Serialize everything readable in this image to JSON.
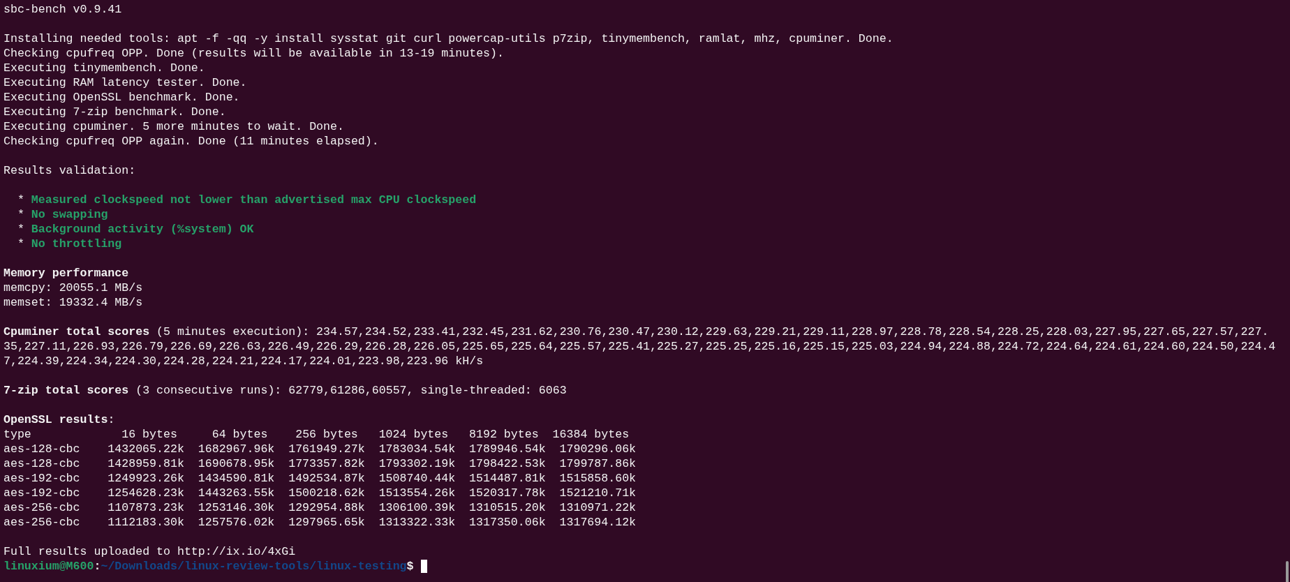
{
  "terminal": {
    "lines": [
      {
        "kind": "text",
        "text": "sbc-bench v0.9.41"
      },
      {
        "kind": "blank"
      },
      {
        "kind": "text",
        "text": "Installing needed tools: apt -f -qq -y install sysstat git curl powercap-utils p7zip, tinymembench, ramlat, mhz, cpuminer. Done."
      },
      {
        "kind": "text",
        "text": "Checking cpufreq OPP. Done (results will be available in 13-19 minutes)."
      },
      {
        "kind": "text",
        "text": "Executing tinymembench. Done."
      },
      {
        "kind": "text",
        "text": "Executing RAM latency tester. Done."
      },
      {
        "kind": "text",
        "text": "Executing OpenSSL benchmark. Done."
      },
      {
        "kind": "text",
        "text": "Executing 7-zip benchmark. Done."
      },
      {
        "kind": "text",
        "text": "Executing cpuminer. 5 more minutes to wait. Done."
      },
      {
        "kind": "text",
        "text": "Checking cpufreq OPP again. Done (11 minutes elapsed)."
      },
      {
        "kind": "blank"
      },
      {
        "kind": "text",
        "text": "Results validation:"
      },
      {
        "kind": "blank"
      },
      {
        "kind": "check",
        "bullet": "*",
        "text": "Measured clockspeed not lower than advertised max CPU clockspeed"
      },
      {
        "kind": "check",
        "bullet": "*",
        "text": "No swapping"
      },
      {
        "kind": "check",
        "bullet": "*",
        "text": "Background activity (%system) OK"
      },
      {
        "kind": "check",
        "bullet": "*",
        "text": "No throttling"
      },
      {
        "kind": "blank"
      },
      {
        "kind": "heading",
        "text": "Memory performance"
      },
      {
        "kind": "text",
        "text": "memcpy: 20055.1 MB/s"
      },
      {
        "kind": "text",
        "text": "memset: 19332.4 MB/s"
      },
      {
        "kind": "blank"
      },
      {
        "kind": "rich",
        "text": "**Cpuminer total scores** (5 minutes execution): 234.57,234.52,233.41,232.45,231.62,230.76,230.47,230.12,229.63,229.21,229.11,228.97,228.78,228.54,228.25,228.03,227.95,227.65,227.57,227.35,227.11,226.93,226.79,226.69,226.63,226.49,226.29,226.28,226.05,225.65,225.64,225.57,225.41,225.27,225.25,225.16,225.15,225.03,224.94,224.88,224.72,224.64,224.61,224.60,224.50,224.47,224.39,224.34,224.30,224.28,224.21,224.17,224.01,223.98,223.96 kH/s"
      },
      {
        "kind": "blank"
      },
      {
        "kind": "rich",
        "text": "**7-zip total scores** (3 consecutive runs): 62779,61286,60557, single-threaded: 6063"
      },
      {
        "kind": "blank"
      },
      {
        "kind": "rich",
        "text": "**OpenSSL results**:"
      },
      {
        "kind": "table",
        "columns": [
          "type",
          "16 bytes",
          "64 bytes",
          "256 bytes",
          "1024 bytes",
          "8192 bytes",
          "16384 bytes"
        ],
        "rows": [
          [
            "aes-128-cbc",
            "1432065.22k",
            "1682967.96k",
            "1761949.27k",
            "1783034.54k",
            "1789946.54k",
            "1790296.06k"
          ],
          [
            "aes-128-cbc",
            "1428959.81k",
            "1690678.95k",
            "1773357.82k",
            "1793302.19k",
            "1798422.53k",
            "1799787.86k"
          ],
          [
            "aes-192-cbc",
            "1249923.26k",
            "1434590.81k",
            "1492534.87k",
            "1508740.44k",
            "1514487.81k",
            "1515858.60k"
          ],
          [
            "aes-192-cbc",
            "1254628.23k",
            "1443263.55k",
            "1500218.62k",
            "1513554.26k",
            "1520317.78k",
            "1521210.71k"
          ],
          [
            "aes-256-cbc",
            "1107873.23k",
            "1253146.30k",
            "1292954.88k",
            "1306100.39k",
            "1310515.20k",
            "1310971.22k"
          ],
          [
            "aes-256-cbc",
            "1112183.30k",
            "1257576.02k",
            "1297965.65k",
            "1313322.33k",
            "1317350.06k",
            "1317694.12k"
          ]
        ]
      },
      {
        "kind": "blank"
      },
      {
        "kind": "text",
        "text": "Full results uploaded to http://ix.io/4xGi"
      },
      {
        "kind": "prompt",
        "user": "linuxium@M600",
        "separator": ":",
        "path": "~/Downloads/linux-review-tools/linux-testing",
        "symbol": "$"
      }
    ]
  }
}
